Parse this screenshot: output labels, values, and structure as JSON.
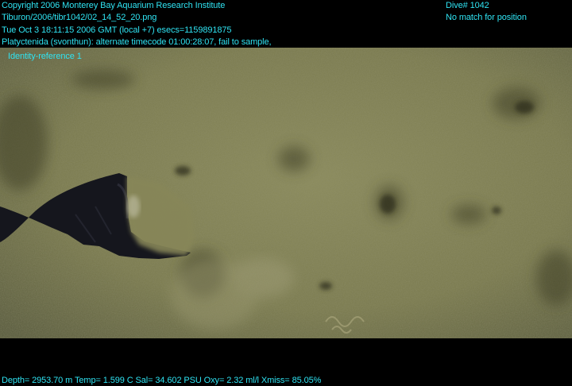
{
  "header": {
    "copyright": "Copyright 2006 Monterey Bay Aquarium Research Institute",
    "image_path": "Tiburon/2006/tibr1042/02_14_52_20.png",
    "datetime": "Tue Oct  3 18:11:15 2006 GMT (local +7)  esecs=1159891875",
    "annotation": "Platyctenida (svonthun): alternate timecode 01:00:28:07, fail to sample,",
    "identity": "Identity-reference 1",
    "dive": "Dive# 1042",
    "position_status": "No match for position"
  },
  "footer": {
    "sensors": "Depth= 2953.70 m  Temp= 1.599 C  Sal= 34.602 PSU  Oxy= 2.32 ml/l  Xmiss= 85.05%"
  },
  "colors": {
    "overlay_text": "#2fe3f2",
    "background": "#000000",
    "sediment": "#7f8052",
    "sampler": "#15161d"
  }
}
